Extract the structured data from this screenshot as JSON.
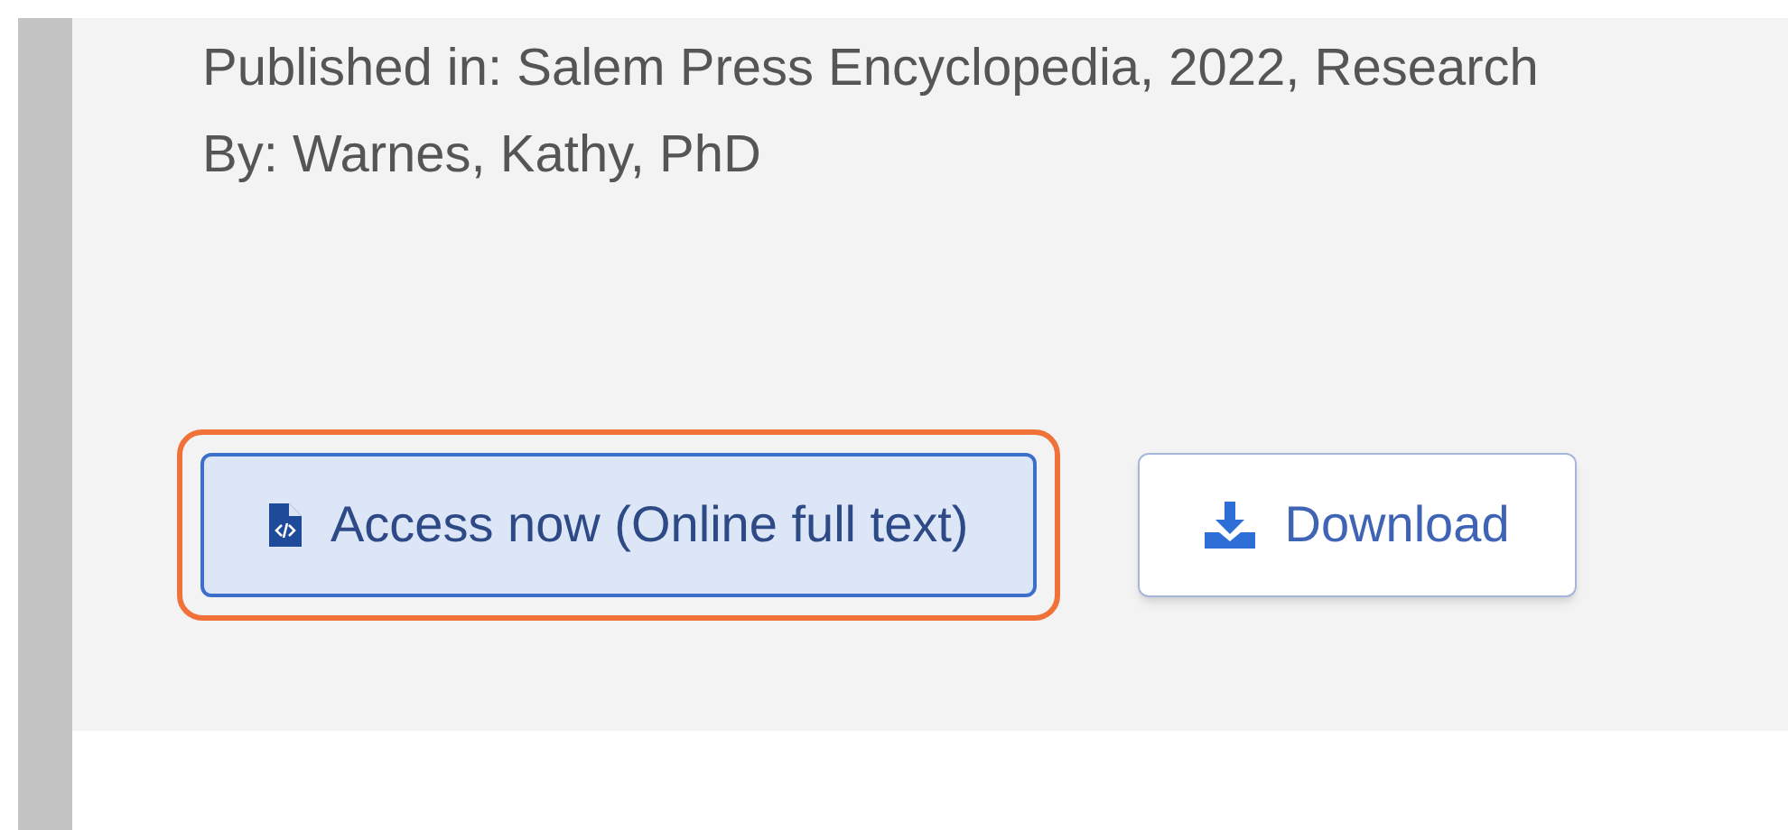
{
  "record": {
    "published_in": "Published in: Salem Press Encyclopedia, 2022, Research",
    "author": "By: Warnes, Kathy, PhD"
  },
  "actions": [
    {
      "kind": "access",
      "label": "Access now (Online full text)",
      "focused": true
    },
    {
      "kind": "download",
      "label": "Download",
      "focused": false
    }
  ]
}
